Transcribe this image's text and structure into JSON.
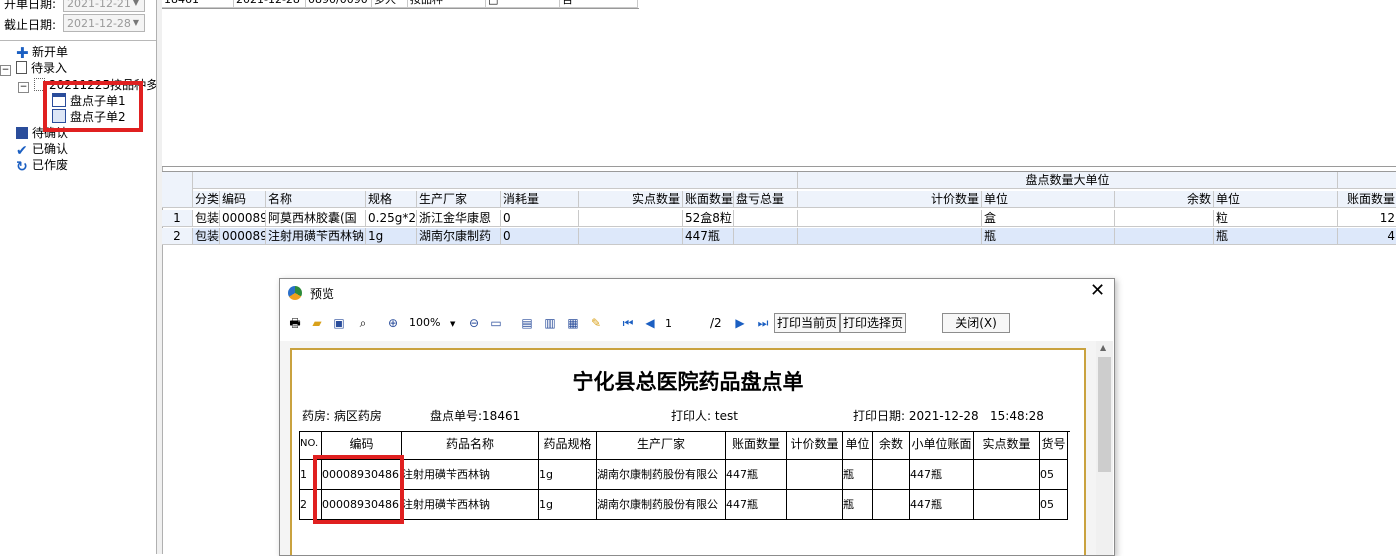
{
  "left": {
    "start_label": "开单日期:",
    "start_date": "2021-12-21",
    "end_label": "截止日期:",
    "end_date": "2021-12-28",
    "tree": {
      "new_order": "新开单",
      "pending_entry": "待录入",
      "batch": "20211225按品种多",
      "sub1": "盘点子单1",
      "sub2": "盘点子单2",
      "pending_confirm": "待确认",
      "confirmed": "已确认",
      "voided": "已作废"
    }
  },
  "top_grid": {
    "row": [
      "18461",
      "2021-12-28",
      "0890/0090",
      "多人",
      "按品种",
      "□",
      "否"
    ]
  },
  "grid": {
    "group_header": "盘点数量大单位",
    "columns": [
      "分类",
      "编码",
      "名称",
      "规格",
      "生产厂家",
      "消耗量",
      "实点数量",
      "账面数量",
      "盘亏总量",
      "计价数量",
      "单位",
      "余数",
      "单位",
      "账面数量"
    ],
    "rows": [
      {
        "no": "1",
        "cells": [
          "包装",
          "000089",
          "阿莫西林胶囊(国",
          "0.25g*2",
          "浙江金华康恩",
          "0",
          "",
          "52盒8粒",
          "",
          "",
          "盒",
          "",
          "粒",
          "12"
        ]
      },
      {
        "no": "2",
        "cells": [
          "包装",
          "000089",
          "注射用磺苄西林钠",
          "1g",
          "湖南尔康制药",
          "0",
          "",
          "447瓶",
          "",
          "",
          "瓶",
          "",
          "瓶",
          "4"
        ]
      }
    ]
  },
  "dialog": {
    "title": "预览",
    "zoom": "100%",
    "page_current": "1",
    "page_total": "/2",
    "btn_print_current": "打印当前页",
    "btn_print_selected": "打印选择页",
    "btn_close": "关闭(X)",
    "report": {
      "title": "宁化县总医院药品盘点单",
      "pharmacy": "药房: 病区药房",
      "order_no": "盘点单号:18461",
      "printer": "打印人:  test",
      "print_date": "打印日期: 2021-12-28   15:48:28",
      "columns": [
        "NO.",
        "编码",
        "药品名称",
        "药品规格",
        "生产厂家",
        "账面数量",
        "计价数量",
        "单位",
        "余数",
        "小单位账面",
        "实点数量",
        "货号"
      ],
      "rows": [
        [
          "1",
          "00008930486",
          "注射用磺苄西林钠",
          "1g",
          "湖南尔康制药股份有限公",
          "447瓶",
          "",
          "瓶",
          "",
          "447瓶",
          "",
          "05"
        ],
        [
          "2",
          "00008930486",
          "注射用磺苄西林钠",
          "1g",
          "湖南尔康制药股份有限公",
          "447瓶",
          "",
          "瓶",
          "",
          "447瓶",
          "",
          "05"
        ]
      ]
    }
  },
  "colors": {
    "highlight": "#e02020",
    "grid_header": "#eef3fb",
    "paper_border": "#c9a23f"
  }
}
